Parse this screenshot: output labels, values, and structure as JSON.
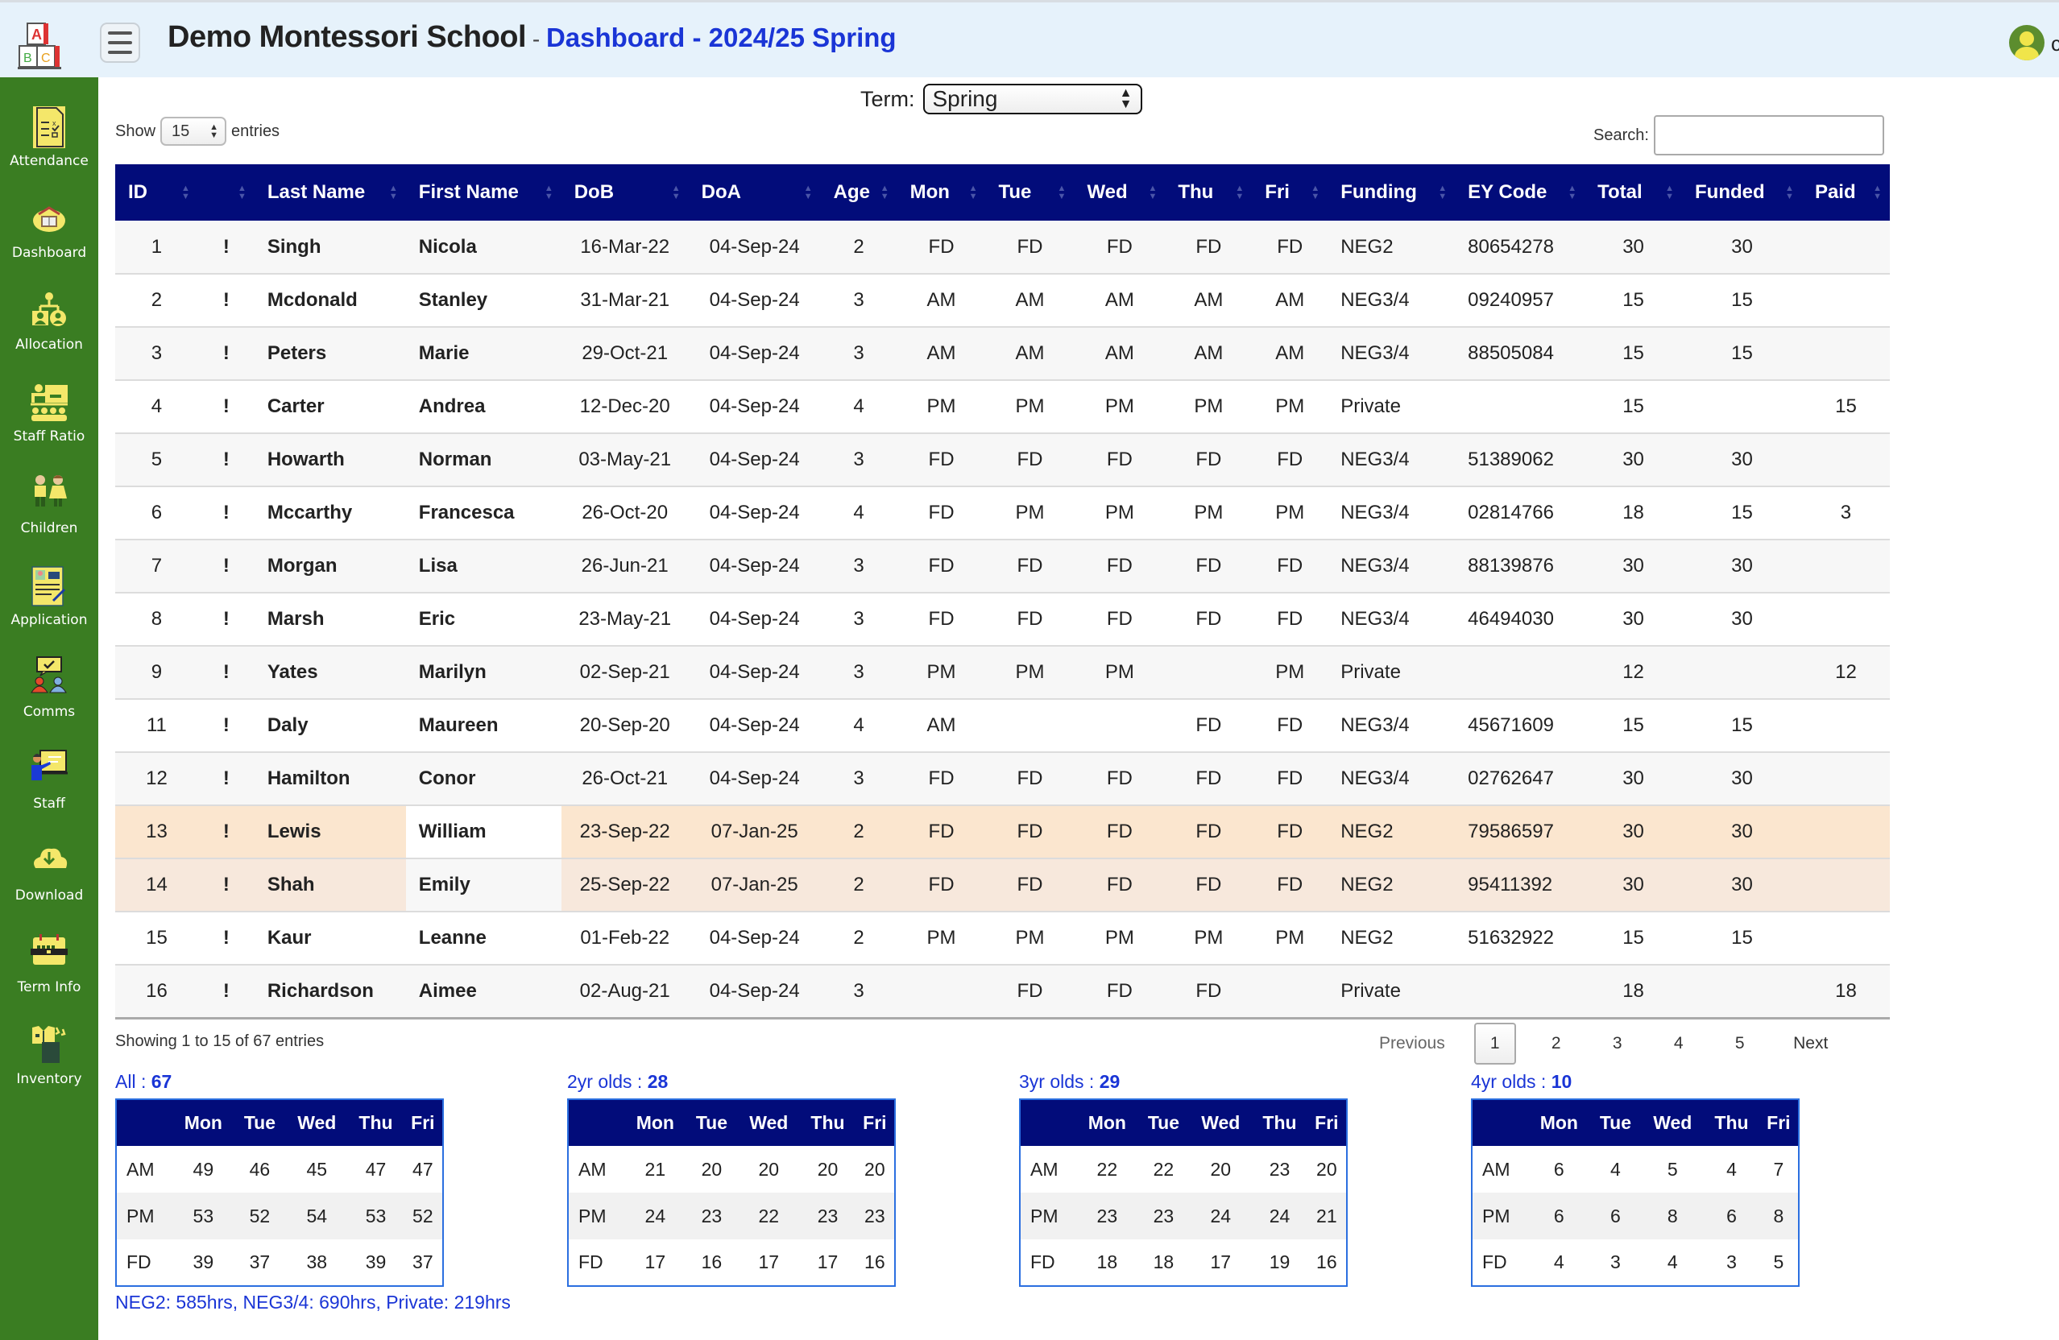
{
  "header": {
    "school": "Demo Montessori School",
    "separator": " - ",
    "page": "Dashboard - 2024/25 Spring",
    "user_initial": "c"
  },
  "sidebar": {
    "items": [
      {
        "label": "Attendance",
        "icon": "attendance-icon"
      },
      {
        "label": "Dashboard",
        "icon": "dashboard-icon"
      },
      {
        "label": "Allocation",
        "icon": "allocation-icon"
      },
      {
        "label": "Staff Ratio",
        "icon": "staff-ratio-icon"
      },
      {
        "label": "Children",
        "icon": "children-icon"
      },
      {
        "label": "Application",
        "icon": "application-icon"
      },
      {
        "label": "Comms",
        "icon": "comms-icon"
      },
      {
        "label": "Staff",
        "icon": "staff-icon"
      },
      {
        "label": "Download",
        "icon": "download-icon"
      },
      {
        "label": "Term Info",
        "icon": "term-info-icon"
      },
      {
        "label": "Inventory",
        "icon": "inventory-icon"
      }
    ]
  },
  "controls": {
    "term_label": "Term:",
    "term_value": "Spring",
    "show_label": "Show",
    "show_value": "15",
    "entries_label": "entries",
    "search_label": "Search:",
    "search_value": ""
  },
  "table": {
    "columns": [
      "ID",
      "",
      "Last Name",
      "First Name",
      "DoB",
      "DoA",
      "Age",
      "Mon",
      "Tue",
      "Wed",
      "Thu",
      "Fri",
      "Funding",
      "EY Code",
      "Total",
      "Funded",
      "Paid"
    ],
    "rows": [
      {
        "id": "1",
        "flag": "!",
        "last": "Singh",
        "first": "Nicola",
        "dob": "16-Mar-22",
        "doa": "04-Sep-24",
        "age": "2",
        "mon": "FD",
        "tue": "FD",
        "wed": "FD",
        "thu": "FD",
        "fri": "FD",
        "funding": "NEG2",
        "ey": "80654278",
        "total": "30",
        "funded": "30",
        "paid": ""
      },
      {
        "id": "2",
        "flag": "!",
        "last": "Mcdonald",
        "first": "Stanley",
        "dob": "31-Mar-21",
        "doa": "04-Sep-24",
        "age": "3",
        "mon": "AM",
        "tue": "AM",
        "wed": "AM",
        "thu": "AM",
        "fri": "AM",
        "funding": "NEG3/4",
        "ey": "09240957",
        "total": "15",
        "funded": "15",
        "paid": ""
      },
      {
        "id": "3",
        "flag": "!",
        "last": "Peters",
        "first": "Marie",
        "dob": "29-Oct-21",
        "doa": "04-Sep-24",
        "age": "3",
        "mon": "AM",
        "tue": "AM",
        "wed": "AM",
        "thu": "AM",
        "fri": "AM",
        "funding": "NEG3/4",
        "ey": "88505084",
        "total": "15",
        "funded": "15",
        "paid": ""
      },
      {
        "id": "4",
        "flag": "!",
        "last": "Carter",
        "first": "Andrea",
        "dob": "12-Dec-20",
        "doa": "04-Sep-24",
        "age": "4",
        "mon": "PM",
        "tue": "PM",
        "wed": "PM",
        "thu": "PM",
        "fri": "PM",
        "funding": "Private",
        "ey": "",
        "total": "15",
        "funded": "",
        "paid": "15"
      },
      {
        "id": "5",
        "flag": "!",
        "last": "Howarth",
        "first": "Norman",
        "dob": "03-May-21",
        "doa": "04-Sep-24",
        "age": "3",
        "mon": "FD",
        "tue": "FD",
        "wed": "FD",
        "thu": "FD",
        "fri": "FD",
        "funding": "NEG3/4",
        "ey": "51389062",
        "total": "30",
        "funded": "30",
        "paid": ""
      },
      {
        "id": "6",
        "flag": "!",
        "last": "Mccarthy",
        "first": "Francesca",
        "dob": "26-Oct-20",
        "doa": "04-Sep-24",
        "age": "4",
        "mon": "FD",
        "tue": "PM",
        "wed": "PM",
        "thu": "PM",
        "fri": "PM",
        "funding": "NEG3/4",
        "ey": "02814766",
        "total": "18",
        "funded": "15",
        "paid": "3"
      },
      {
        "id": "7",
        "flag": "!",
        "last": "Morgan",
        "first": "Lisa",
        "dob": "26-Jun-21",
        "doa": "04-Sep-24",
        "age": "3",
        "mon": "FD",
        "tue": "FD",
        "wed": "FD",
        "thu": "FD",
        "fri": "FD",
        "funding": "NEG3/4",
        "ey": "88139876",
        "total": "30",
        "funded": "30",
        "paid": ""
      },
      {
        "id": "8",
        "flag": "!",
        "last": "Marsh",
        "first": "Eric",
        "dob": "23-May-21",
        "doa": "04-Sep-24",
        "age": "3",
        "mon": "FD",
        "tue": "FD",
        "wed": "FD",
        "thu": "FD",
        "fri": "FD",
        "funding": "NEG3/4",
        "ey": "46494030",
        "total": "30",
        "funded": "30",
        "paid": ""
      },
      {
        "id": "9",
        "flag": "!",
        "last": "Yates",
        "first": "Marilyn",
        "dob": "02-Sep-21",
        "doa": "04-Sep-24",
        "age": "3",
        "mon": "PM",
        "tue": "PM",
        "wed": "PM",
        "thu": "",
        "fri": "PM",
        "funding": "Private",
        "ey": "",
        "total": "12",
        "funded": "",
        "paid": "12"
      },
      {
        "id": "11",
        "flag": "!",
        "last": "Daly",
        "first": "Maureen",
        "dob": "20-Sep-20",
        "doa": "04-Sep-24",
        "age": "4",
        "mon": "AM",
        "tue": "",
        "wed": "",
        "thu": "FD",
        "fri": "FD",
        "funding": "NEG3/4",
        "ey": "45671609",
        "total": "15",
        "funded": "15",
        "paid": ""
      },
      {
        "id": "12",
        "flag": "!",
        "last": "Hamilton",
        "first": "Conor",
        "dob": "26-Oct-21",
        "doa": "04-Sep-24",
        "age": "3",
        "mon": "FD",
        "tue": "FD",
        "wed": "FD",
        "thu": "FD",
        "fri": "FD",
        "funding": "NEG3/4",
        "ey": "02762647",
        "total": "30",
        "funded": "30",
        "paid": ""
      },
      {
        "id": "13",
        "flag": "!",
        "last": "Lewis",
        "first": "William",
        "dob": "23-Sep-22",
        "doa": "07-Jan-25",
        "age": "2",
        "mon": "FD",
        "tue": "FD",
        "wed": "FD",
        "thu": "FD",
        "fri": "FD",
        "funding": "NEG2",
        "ey": "79586597",
        "total": "30",
        "funded": "30",
        "paid": "",
        "highlight": "hl1"
      },
      {
        "id": "14",
        "flag": "!",
        "last": "Shah",
        "first": "Emily",
        "dob": "25-Sep-22",
        "doa": "07-Jan-25",
        "age": "2",
        "mon": "FD",
        "tue": "FD",
        "wed": "FD",
        "thu": "FD",
        "fri": "FD",
        "funding": "NEG2",
        "ey": "95411392",
        "total": "30",
        "funded": "30",
        "paid": "",
        "highlight": "hl2"
      },
      {
        "id": "15",
        "flag": "!",
        "last": "Kaur",
        "first": "Leanne",
        "dob": "01-Feb-22",
        "doa": "04-Sep-24",
        "age": "2",
        "mon": "PM",
        "tue": "PM",
        "wed": "PM",
        "thu": "PM",
        "fri": "PM",
        "funding": "NEG2",
        "ey": "51632922",
        "total": "15",
        "funded": "15",
        "paid": ""
      },
      {
        "id": "16",
        "flag": "!",
        "last": "Richardson",
        "first": "Aimee",
        "dob": "02-Aug-21",
        "doa": "04-Sep-24",
        "age": "3",
        "mon": "",
        "tue": "FD",
        "wed": "FD",
        "thu": "FD",
        "fri": "",
        "funding": "Private",
        "ey": "",
        "total": "18",
        "funded": "",
        "paid": "18"
      }
    ]
  },
  "footer": {
    "info": "Showing 1 to 15 of 67 entries",
    "pagination": {
      "previous": "Previous",
      "pages": [
        "1",
        "2",
        "3",
        "4",
        "5"
      ],
      "active": "1",
      "next": "Next"
    }
  },
  "summaries": [
    {
      "label": "All : ",
      "count": "67",
      "days": [
        "Mon",
        "Tue",
        "Wed",
        "Thu",
        "Fri"
      ],
      "rows": [
        [
          "AM",
          "49",
          "46",
          "45",
          "47",
          "47"
        ],
        [
          "PM",
          "53",
          "52",
          "54",
          "53",
          "52"
        ],
        [
          "FD",
          "39",
          "37",
          "38",
          "39",
          "37"
        ]
      ]
    },
    {
      "label": "2yr olds : ",
      "count": "28",
      "days": [
        "Mon",
        "Tue",
        "Wed",
        "Thu",
        "Fri"
      ],
      "rows": [
        [
          "AM",
          "21",
          "20",
          "20",
          "20",
          "20"
        ],
        [
          "PM",
          "24",
          "23",
          "22",
          "23",
          "23"
        ],
        [
          "FD",
          "17",
          "16",
          "17",
          "17",
          "16"
        ]
      ]
    },
    {
      "label": "3yr olds : ",
      "count": "29",
      "days": [
        "Mon",
        "Tue",
        "Wed",
        "Thu",
        "Fri"
      ],
      "rows": [
        [
          "AM",
          "22",
          "22",
          "20",
          "23",
          "20"
        ],
        [
          "PM",
          "23",
          "23",
          "24",
          "24",
          "21"
        ],
        [
          "FD",
          "18",
          "18",
          "17",
          "19",
          "16"
        ]
      ]
    },
    {
      "label": "4yr olds : ",
      "count": "10",
      "days": [
        "Mon",
        "Tue",
        "Wed",
        "Thu",
        "Fri"
      ],
      "rows": [
        [
          "AM",
          "6",
          "4",
          "5",
          "4",
          "7"
        ],
        [
          "PM",
          "6",
          "6",
          "8",
          "6",
          "8"
        ],
        [
          "FD",
          "4",
          "3",
          "4",
          "3",
          "5"
        ]
      ]
    }
  ],
  "hours_note": "NEG2: 585hrs, NEG3/4: 690hrs, Private: 219hrs",
  "colors": {
    "header_bg": "#e6f2fb",
    "sidebar_bg": "#3a7d22",
    "table_header_bg": "#020c7a",
    "accent_blue": "#1a35d6",
    "alert_red": "#e0252b",
    "highlight_row": "#fbe6cf"
  }
}
